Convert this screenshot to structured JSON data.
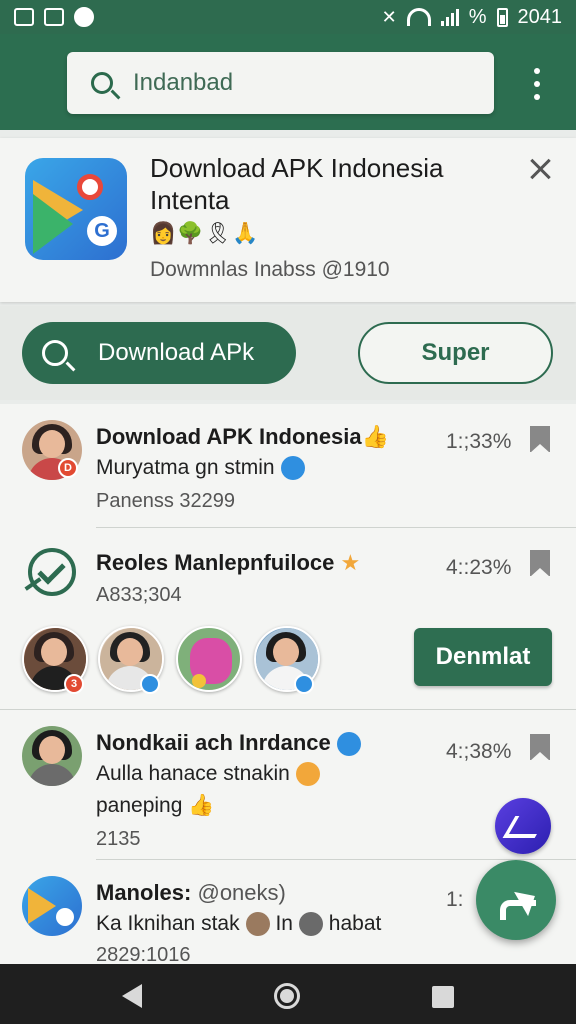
{
  "status_bar": {
    "percent": "%",
    "time": "2041"
  },
  "search": {
    "query": "Indanbad"
  },
  "banner": {
    "title": "Download APK Indonesia Intenta",
    "emojis": "👩🌳🎗🙏",
    "subtitle": "Dowmnlas Inabss @1910"
  },
  "actions": {
    "download_label": "Download APk",
    "super_label": "Super"
  },
  "list": [
    {
      "title": "Download APK Indonesia",
      "title_emoji": "👍",
      "line1": "Muryatma gn stmin",
      "meta": "Panenss 32299",
      "percent": "1:;33%"
    },
    {
      "title": "Reoles Manlepnfuiloce",
      "title_emoji": "★",
      "line1": "A833;304",
      "percent": "4::23%",
      "button_label": "Denmlat"
    },
    {
      "title": "Nondkaii ach Inrdance",
      "line1": "Aulla hanace stnakin",
      "line2": "paneping",
      "line2_emoji": "👍",
      "meta": "2135",
      "percent": "4:;38%"
    },
    {
      "title": "Manoles:",
      "handle": "@oneks)",
      "line1_a": "Ka Iknihan stak",
      "line1_b": "In",
      "line1_c": "habat",
      "meta": "2829:1016",
      "percent": "1:"
    }
  ],
  "colors": {
    "primary": "#2e6e51",
    "accent": "#f2a73a"
  }
}
